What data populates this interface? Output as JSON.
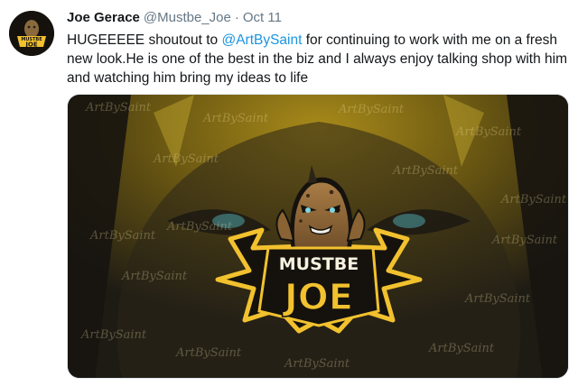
{
  "tweet": {
    "author_name": "Joe Gerace",
    "handle": "@Mustbe_Joe",
    "separator": "·",
    "date": "Oct 11",
    "text_before": "HUGEEEEE shoutout to ",
    "mention": "@ArtBySaint",
    "text_after": " for continuing to work with me on a fresh new look.He is one of the best in the biz and I always enjoy talking shop with him and watching him bring my ideas to life",
    "media": {
      "logo_line1": "MUSTBE",
      "logo_line2": "JOE",
      "watermark": "ArtBySaint"
    },
    "avatar": {
      "line1": "MUSTBE",
      "line2": "JOE"
    }
  },
  "colors": {
    "accent": "#1b95e0",
    "gold": "#f2c12e",
    "dark": "#15120e"
  }
}
